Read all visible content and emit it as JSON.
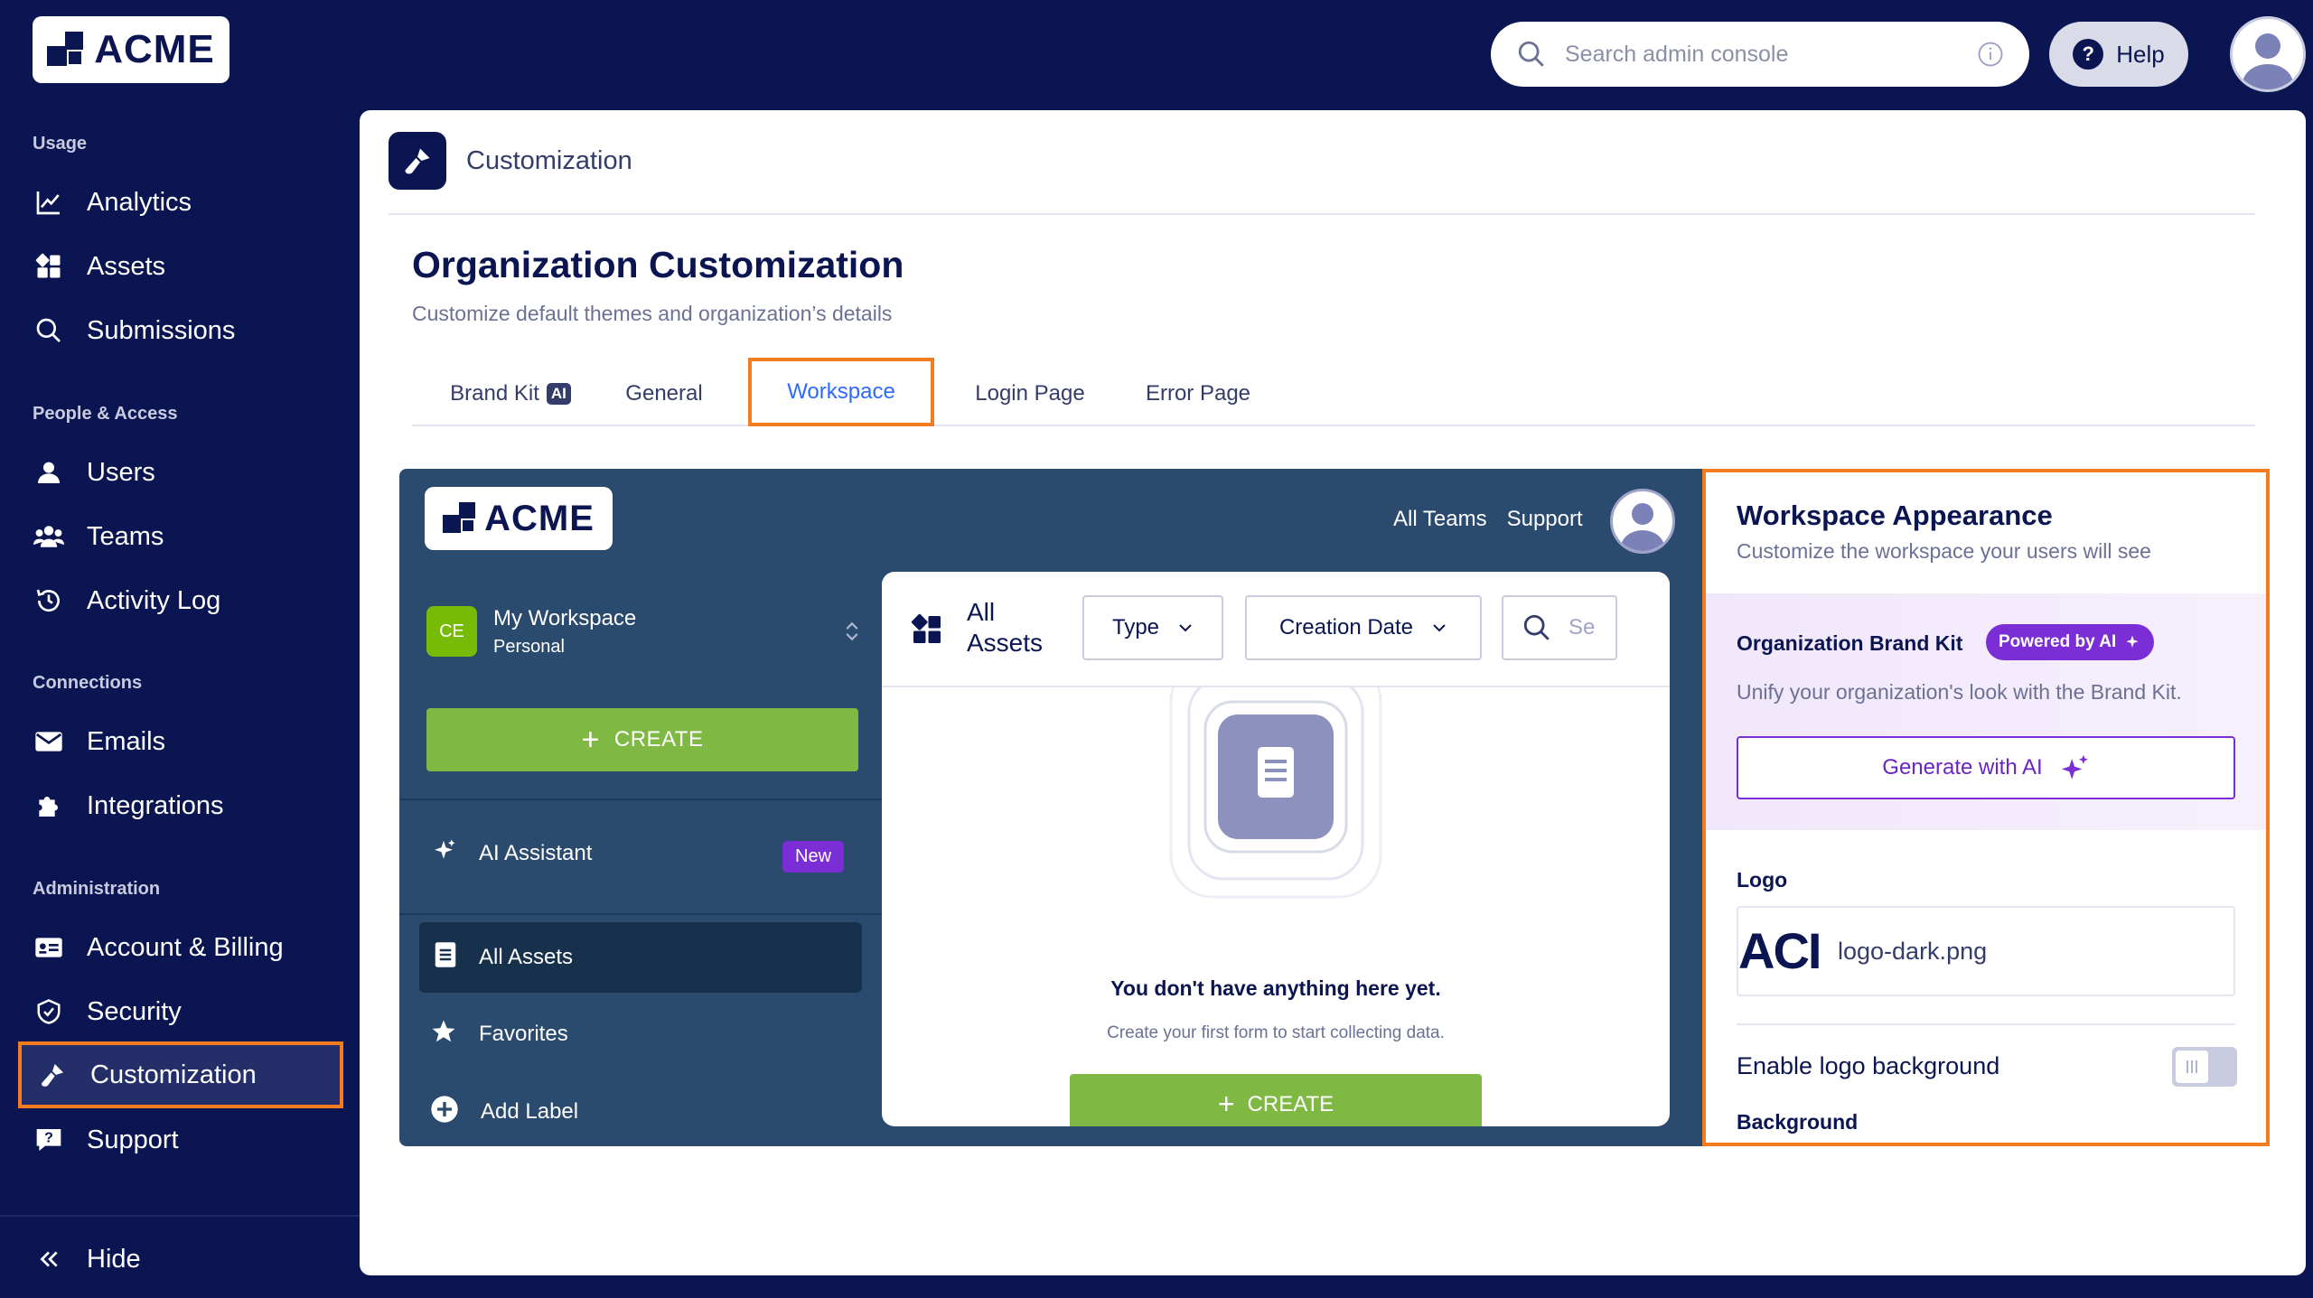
{
  "brand": {
    "logo_text": "ACME"
  },
  "topbar": {
    "search_placeholder": "Search admin console",
    "help_label": "Help"
  },
  "sidebar": {
    "sections": [
      {
        "title": "Usage",
        "items": [
          "Analytics",
          "Assets",
          "Submissions"
        ]
      },
      {
        "title": "People & Access",
        "items": [
          "Users",
          "Teams",
          "Activity Log"
        ]
      },
      {
        "title": "Connections",
        "items": [
          "Emails",
          "Integrations"
        ]
      },
      {
        "title": "Administration",
        "items": [
          "Account & Billing",
          "Security",
          "Customization",
          "Support"
        ]
      }
    ],
    "active_item": "Customization",
    "hide_label": "Hide"
  },
  "main": {
    "breadcrumb": "Customization",
    "title": "Organization Customization",
    "subtitle": "Customize default themes and organization’s details",
    "tabs": [
      {
        "label": "Brand Kit",
        "badge": "AI"
      },
      {
        "label": "General"
      },
      {
        "label": "Workspace",
        "active": true
      },
      {
        "label": "Login Page"
      },
      {
        "label": "Error Page"
      }
    ]
  },
  "preview": {
    "logo_text": "ACME",
    "top_links": [
      "All Teams",
      "Support"
    ],
    "workspace": {
      "initials": "CE",
      "name": "My Workspace",
      "type": "Personal"
    },
    "create_label": "CREATE",
    "ai_assistant": {
      "label": "AI Assistant",
      "badge": "New"
    },
    "nav_items": [
      "All Assets",
      "Favorites",
      "Add Label"
    ],
    "toolbar": {
      "all_assets": "All Assets",
      "filters": [
        "Type",
        "Creation Date"
      ],
      "search_partial": "Se"
    },
    "empty_title": "You don't have anything here yet.",
    "empty_sub": "Create your first form to start collecting data.",
    "create_label_2": "CREATE"
  },
  "panel": {
    "title": "Workspace Appearance",
    "subtitle": "Customize the workspace your users will see",
    "brand_kit_title": "Organization Brand Kit",
    "powered_badge": "Powered by AI",
    "brand_kit_sub": "Unify your organization's look with the Brand Kit.",
    "generate_label": "Generate with AI",
    "logo_label": "Logo",
    "logo_preview_text": "ACI",
    "logo_file": "logo-dark.png",
    "toggle_label": "Enable logo background",
    "toggle_on": false,
    "background_label": "Background"
  },
  "colors": {
    "navy": "#0a1551",
    "highlight": "#f47c20",
    "accent_blue": "#2e69ff",
    "green": "#7fb842",
    "purple": "#7b2ed6",
    "preview_bg": "#2a4a6e"
  }
}
